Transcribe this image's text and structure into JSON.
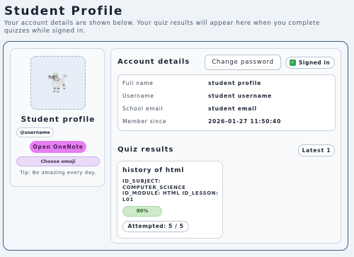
{
  "header": {
    "title": "Student Profile",
    "subtitle": "Your account details are shown below. Your quiz results will appear here when you complete quizzes while signed in."
  },
  "profile_card": {
    "avatar_emoji": "🐩",
    "title": "Student profile",
    "username_chip": "@username",
    "onenote_label": "Open OneNote",
    "emoji_label": "Choose emoji",
    "tip": "Tip: Be amazing every day."
  },
  "account": {
    "heading": "Account details",
    "change_password_label": "Change password",
    "signed_in_label": "Signed in",
    "signed_in": true,
    "rows": [
      {
        "label": "Full name",
        "value": "student profile"
      },
      {
        "label": "Username",
        "value": "student username"
      },
      {
        "label": "School email",
        "value": "student email"
      },
      {
        "label": "Member since",
        "value": "2026-01-27 11:50:40"
      }
    ]
  },
  "quiz": {
    "heading": "Quiz results",
    "filter_label": "Latest 1",
    "results": [
      {
        "title": "history of html",
        "meta": "ID_SUBJECT: COMPUTER_SCIENCE ID_MODULE: HTML ID_LESSON: L01",
        "score": "80%",
        "attempted": "Attempted: 5 / 5"
      }
    ]
  },
  "colors": {
    "outer_border": "#3e5e7e",
    "onenote_button": "#e67ef2",
    "score_green": "#cfeacb",
    "check_green": "#2ea44f"
  }
}
